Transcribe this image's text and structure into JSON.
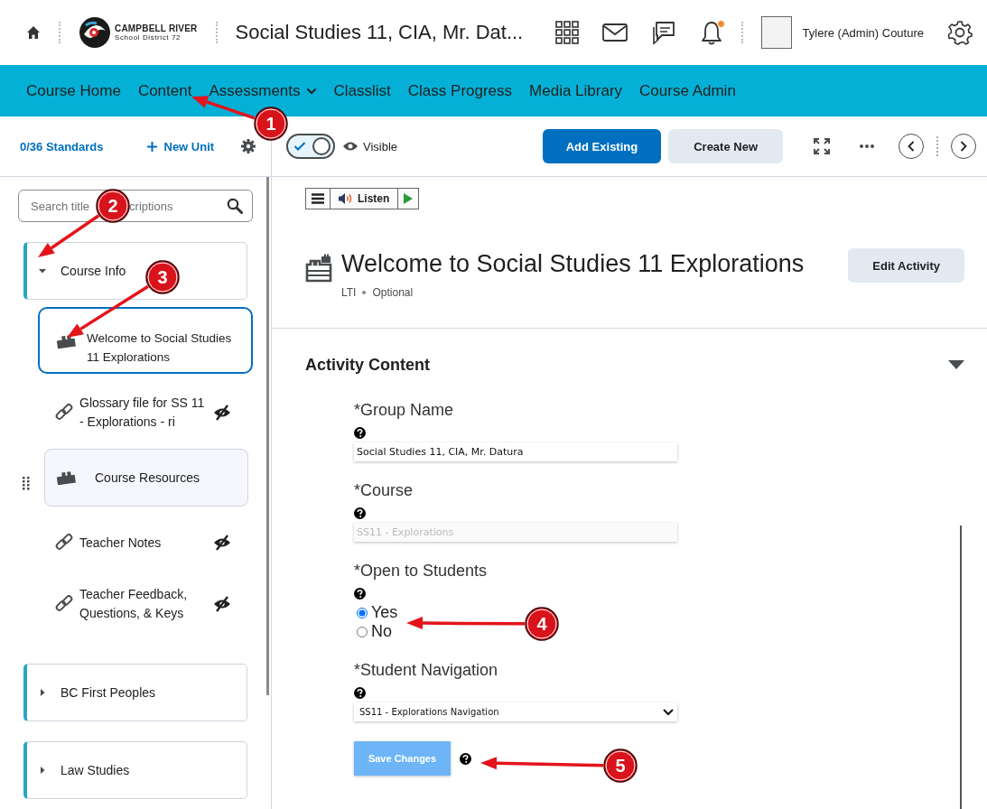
{
  "header": {
    "logo": {
      "name": "CAMPBELL RIVER",
      "subtitle": "School District 72"
    },
    "title": "Social Studies 11, CIA, Mr. Dat...",
    "has_notification": true,
    "user_name": "Tylere (Admin) Couture"
  },
  "nav": [
    {
      "label": "Course Home",
      "dropdown": false
    },
    {
      "label": "Content",
      "dropdown": false
    },
    {
      "label": "Assessments",
      "dropdown": true
    },
    {
      "label": "Classlist",
      "dropdown": false
    },
    {
      "label": "Class Progress",
      "dropdown": false
    },
    {
      "label": "Media Library",
      "dropdown": false
    },
    {
      "label": "Course Admin",
      "dropdown": false
    }
  ],
  "toolbar": {
    "standards": "0/36 Standards",
    "new_unit": "New Unit",
    "visible_toggle": {
      "on": true,
      "label": "Visible"
    },
    "buttons": [
      {
        "label": "Add Existing",
        "kind": "primary"
      },
      {
        "label": "Create New",
        "kind": "secondary"
      }
    ]
  },
  "search": {
    "placeholder": [
      "Search title",
      "criptions"
    ]
  },
  "units": [
    {
      "title": "Course Info",
      "expanded": true,
      "children": [
        {
          "kind": "activity",
          "title": "Welcome to Social Studies 11 Explorations",
          "selected": true,
          "hidden": false
        },
        {
          "kind": "link",
          "title": "Glossary file for SS 11 - Explorations - ri",
          "selected": false,
          "hidden": true
        },
        {
          "kind": "lesson",
          "title": "Course Resources",
          "selected": false,
          "hidden": false
        },
        {
          "kind": "link",
          "title": "Teacher Notes",
          "selected": false,
          "hidden": true
        },
        {
          "kind": "link",
          "title": "Teacher Feedback, Questions, & Keys",
          "selected": false,
          "hidden": true
        }
      ]
    },
    {
      "title": "BC First Peoples",
      "expanded": false
    },
    {
      "title": "Law Studies",
      "expanded": false
    }
  ],
  "listen": {
    "label": "Listen"
  },
  "activity": {
    "title": "Welcome to Social Studies 11 Explorations",
    "meta": [
      "LTI",
      "Optional"
    ],
    "edit_button": "Edit Activity"
  },
  "section": {
    "title": "Activity Content",
    "expanded": true
  },
  "form": {
    "fields": [
      {
        "kind": "text",
        "label": "*Group Name",
        "value": "Social Studies 11, CIA, Mr. Datura",
        "disabled": false
      },
      {
        "kind": "text",
        "label": "*Course",
        "value": "SS11 - Explorations",
        "disabled": true
      },
      {
        "kind": "radio",
        "label": "*Open to Students",
        "options": [
          {
            "label": "Yes",
            "selected": true
          },
          {
            "label": "No",
            "selected": false
          }
        ]
      },
      {
        "kind": "select",
        "label": "*Student Navigation",
        "value": "SS11 - Explorations Navigation"
      }
    ],
    "submit": "Save Changes"
  },
  "annotations": [
    {
      "number": "1"
    },
    {
      "number": "2"
    },
    {
      "number": "3"
    },
    {
      "number": "4"
    },
    {
      "number": "5"
    }
  ]
}
